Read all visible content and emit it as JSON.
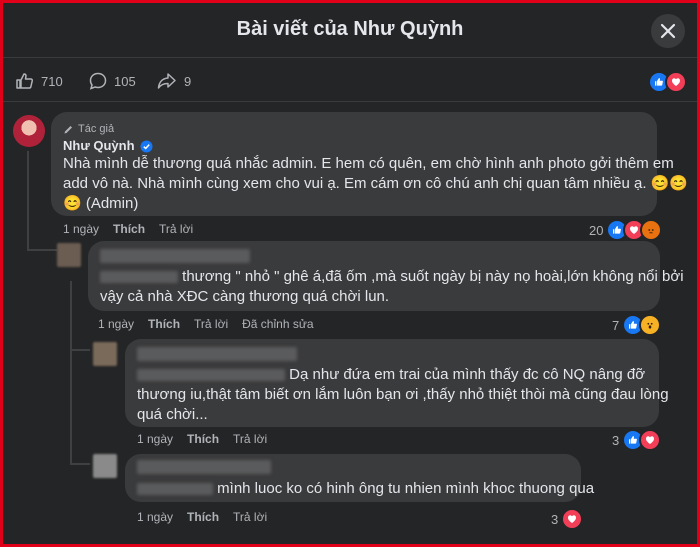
{
  "header": {
    "title": "Bài viết của Như Quỳnh"
  },
  "stats": {
    "likes": "710",
    "comments": "105",
    "shares": "9"
  },
  "colors": {
    "border": "#e0001a",
    "background": "#242526",
    "bubble": "#3a3b3c",
    "like_blue": "#1877f2",
    "love_red": "#f33e58"
  },
  "comments": [
    {
      "author_badge": "Tác giả",
      "author": "Như Quỳnh",
      "text_line1": "Nhà mình dễ thương quá nhắc admin. E hem có quên, em chờ hình anh photo gởi thêm em",
      "text_line2": "add vô nà. Nhà mình cùng xem cho vui ạ. Em cám ơn cô chú anh chị quan tâm nhiều ạ. 😊😊",
      "text_line3": "😊 (Admin)",
      "time": "1 ngày",
      "like": "Thích",
      "reply": "Trả lời",
      "reaction_count": "20"
    },
    {
      "text_line1": "thương \" nhỏ \" ghê á,đã ốm ,mà suốt ngày bị này nọ hoài,lớn không nổi bởi",
      "text_line2": "vậy cả nhà XĐC càng thương quá chời lun.",
      "time": "1 ngày",
      "like": "Thích",
      "reply": "Trả lời",
      "edited": "Đã chỉnh sửa",
      "reaction_count": "7"
    },
    {
      "text_line1": "Dạ như đứa em trai của mình thấy đc cô NQ nâng đỡ",
      "text_line2": "thương iu,thật tâm biết ơn lắm luôn bạn ơi ,thấy nhỏ thiệt thòi mà cũng đau lòng",
      "text_line3": "quá chời...",
      "time": "1 ngày",
      "like": "Thích",
      "reply": "Trả lời",
      "reaction_count": "3"
    },
    {
      "text_line1": "mình luoc ko có hinh ông tu nhien mình khoc thuong qua",
      "time": "1 ngày",
      "like": "Thích",
      "reply": "Trả lời",
      "reaction_count": "3"
    }
  ]
}
